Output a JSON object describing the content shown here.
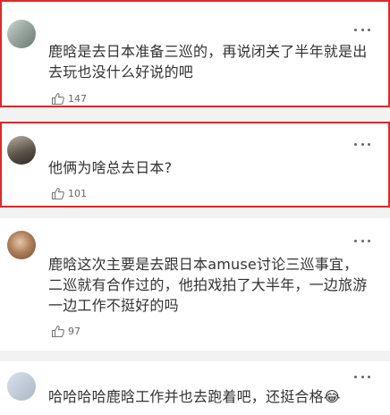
{
  "comments": [
    {
      "text": "鹿晗是去日本准备三巡的，再说闭关了半年就是出去玩也没什么好说的吧",
      "likes": "147",
      "highlighted": true
    },
    {
      "text": "他俩为啥总去日本?",
      "likes": "101",
      "highlighted": true
    },
    {
      "text": "鹿晗这次主要是去跟日本amuse讨论三巡事宜，二巡就有合作过的，他拍戏拍了大半年，一边旅游一边工作不挺好的吗",
      "likes": "97",
      "highlighted": false
    },
    {
      "text": "哈哈哈哈鹿晗工作并也去跑着吧，还挺合格😂",
      "likes": "",
      "highlighted": false
    }
  ],
  "icons": {
    "menu": "more-dots-icon",
    "like": "thumbs-up-icon"
  },
  "colors": {
    "highlight": "#e0292b",
    "background": "#f2f2f2"
  }
}
